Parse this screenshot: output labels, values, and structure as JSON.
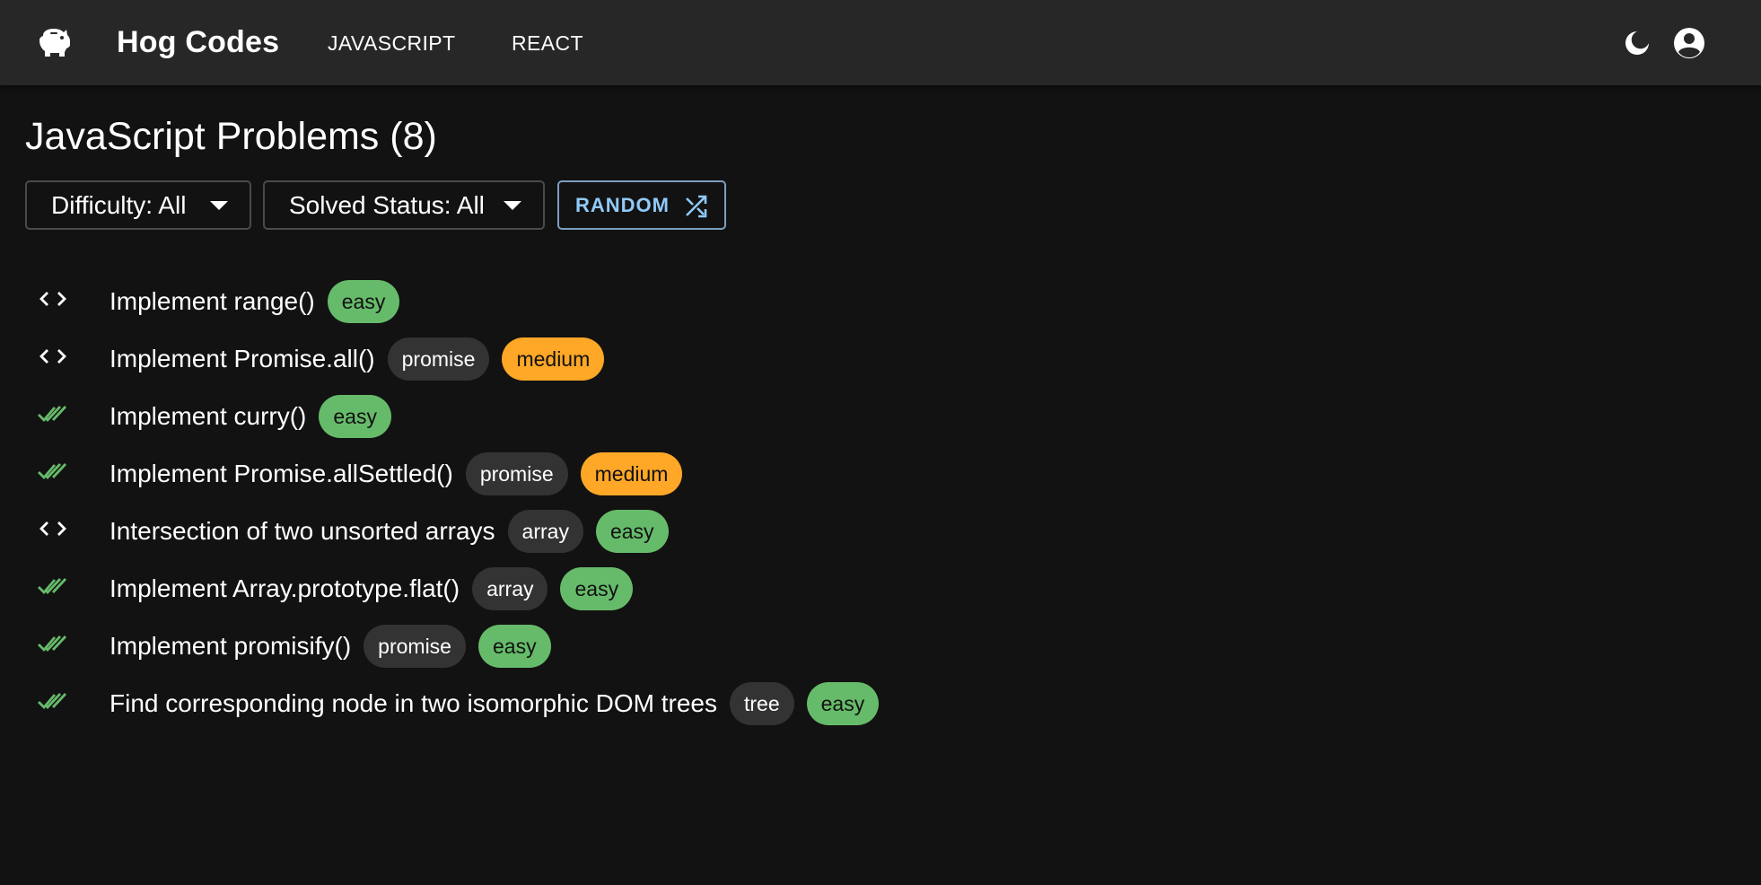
{
  "colors": {
    "background": "#121212",
    "appbar": "#272727",
    "easy": "#66bb6a",
    "medium": "#ffa726",
    "tag": "#333333",
    "accent": "#90caf9",
    "solved_check": "#66bb6a"
  },
  "header": {
    "logo_icon": "piggy-bank-icon",
    "brand": "Hog Codes",
    "nav": [
      {
        "label": "JAVASCRIPT"
      },
      {
        "label": "REACT"
      }
    ],
    "theme_icon": "dark-mode-icon",
    "account_icon": "account-circle-icon"
  },
  "main": {
    "title": "JavaScript Problems (8)",
    "filters": {
      "difficulty_label": "Difficulty: All",
      "status_label": "Solved Status: All",
      "random_label": "RANDOM",
      "random_icon": "shuffle-icon"
    },
    "problems": [
      {
        "status": "unsolved",
        "status_icon": "code-icon",
        "title": "Implement range()",
        "tags": [],
        "difficulty": "easy"
      },
      {
        "status": "unsolved",
        "status_icon": "code-icon",
        "title": "Implement Promise.all()",
        "tags": [
          "promise"
        ],
        "difficulty": "medium"
      },
      {
        "status": "solved",
        "status_icon": "double-check-icon",
        "title": "Implement curry()",
        "tags": [],
        "difficulty": "easy"
      },
      {
        "status": "solved",
        "status_icon": "double-check-icon",
        "title": "Implement Promise.allSettled()",
        "tags": [
          "promise"
        ],
        "difficulty": "medium"
      },
      {
        "status": "unsolved",
        "status_icon": "code-icon",
        "title": "Intersection of two unsorted arrays",
        "tags": [
          "array"
        ],
        "difficulty": "easy"
      },
      {
        "status": "solved",
        "status_icon": "double-check-icon",
        "title": "Implement Array.prototype.flat()",
        "tags": [
          "array"
        ],
        "difficulty": "easy"
      },
      {
        "status": "solved",
        "status_icon": "double-check-icon",
        "title": "Implement promisify()",
        "tags": [
          "promise"
        ],
        "difficulty": "easy"
      },
      {
        "status": "solved",
        "status_icon": "double-check-icon",
        "title": "Find corresponding node in two isomorphic DOM trees",
        "tags": [
          "tree"
        ],
        "difficulty": "easy"
      }
    ]
  }
}
